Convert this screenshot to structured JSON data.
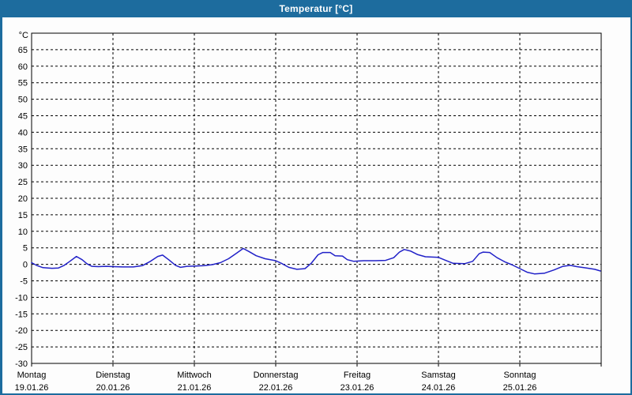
{
  "window": {
    "title": "Temperatur [°C]"
  },
  "colors": {
    "titlebar": "#1d6c9e",
    "window_border": "#1d6c9e",
    "content_bg": "#fdfdfd",
    "grid": "#000000",
    "axis": "#000000",
    "title_text": "#ffffff",
    "series_line": "#2121c8"
  },
  "chart_data": {
    "type": "line",
    "title": "Temperatur [°C]",
    "ylabel": "°C",
    "grid": {
      "style": "dashed",
      "horizontal": true,
      "vertical": true
    },
    "legend": "none",
    "y_axis": {
      "unit": "°C",
      "tick_min": -30,
      "tick_max": 65,
      "step": 5,
      "plot_top": 70,
      "ticks": [
        65,
        60,
        55,
        50,
        45,
        40,
        35,
        30,
        25,
        20,
        15,
        10,
        5,
        0,
        -5,
        -10,
        -15,
        -20,
        -25,
        -30
      ]
    },
    "x_axis": {
      "span_days": 7,
      "days": [
        {
          "name": "Montag",
          "date": "19.01.26"
        },
        {
          "name": "Dienstag",
          "date": "20.01.26"
        },
        {
          "name": "Mittwoch",
          "date": "21.01.26"
        },
        {
          "name": "Donnerstag",
          "date": "22.01.26"
        },
        {
          "name": "Freitag",
          "date": "23.01.26"
        },
        {
          "name": "Samstag",
          "date": "24.01.26"
        },
        {
          "name": "Sonntag",
          "date": "25.01.26"
        }
      ]
    },
    "series": [
      {
        "name": "Temperatur",
        "color": "#2121c8",
        "points_day_degC": [
          [
            0.0,
            0.5
          ],
          [
            0.06,
            -0.3
          ],
          [
            0.14,
            -1.0
          ],
          [
            0.25,
            -1.2
          ],
          [
            0.33,
            -1.1
          ],
          [
            0.4,
            -0.3
          ],
          [
            0.47,
            0.9
          ],
          [
            0.55,
            2.4
          ],
          [
            0.62,
            1.4
          ],
          [
            0.68,
            0.2
          ],
          [
            0.74,
            -0.6
          ],
          [
            0.82,
            -0.7
          ],
          [
            0.92,
            -0.6
          ],
          [
            1.0,
            -0.7
          ],
          [
            1.12,
            -0.8
          ],
          [
            1.25,
            -0.8
          ],
          [
            1.36,
            -0.4
          ],
          [
            1.46,
            0.9
          ],
          [
            1.55,
            2.4
          ],
          [
            1.61,
            2.8
          ],
          [
            1.69,
            1.3
          ],
          [
            1.77,
            -0.3
          ],
          [
            1.83,
            -0.9
          ],
          [
            1.91,
            -0.6
          ],
          [
            2.02,
            -0.5
          ],
          [
            2.12,
            -0.4
          ],
          [
            2.22,
            -0.1
          ],
          [
            2.32,
            0.5
          ],
          [
            2.42,
            1.7
          ],
          [
            2.52,
            3.4
          ],
          [
            2.6,
            4.8
          ],
          [
            2.67,
            3.9
          ],
          [
            2.76,
            2.6
          ],
          [
            2.87,
            1.7
          ],
          [
            3.0,
            1.1
          ],
          [
            3.07,
            0.3
          ],
          [
            3.16,
            -0.9
          ],
          [
            3.26,
            -1.5
          ],
          [
            3.36,
            -1.3
          ],
          [
            3.44,
            0.4
          ],
          [
            3.52,
            2.9
          ],
          [
            3.58,
            3.6
          ],
          [
            3.67,
            3.6
          ],
          [
            3.73,
            2.6
          ],
          [
            3.82,
            2.5
          ],
          [
            3.88,
            1.4
          ],
          [
            3.96,
            0.9
          ],
          [
            4.08,
            1.1
          ],
          [
            4.22,
            1.1
          ],
          [
            4.35,
            1.2
          ],
          [
            4.45,
            2.0
          ],
          [
            4.52,
            3.7
          ],
          [
            4.58,
            4.5
          ],
          [
            4.66,
            4.0
          ],
          [
            4.74,
            3.0
          ],
          [
            4.84,
            2.3
          ],
          [
            5.0,
            2.1
          ],
          [
            5.08,
            1.3
          ],
          [
            5.18,
            0.3
          ],
          [
            5.32,
            0.2
          ],
          [
            5.42,
            0.9
          ],
          [
            5.5,
            3.2
          ],
          [
            5.55,
            3.7
          ],
          [
            5.63,
            3.6
          ],
          [
            5.72,
            2.0
          ],
          [
            5.82,
            0.7
          ],
          [
            5.9,
            -0.1
          ],
          [
            6.0,
            -1.3
          ],
          [
            6.09,
            -2.4
          ],
          [
            6.18,
            -2.9
          ],
          [
            6.3,
            -2.7
          ],
          [
            6.42,
            -1.7
          ],
          [
            6.53,
            -0.6
          ],
          [
            6.62,
            -0.3
          ],
          [
            6.7,
            -0.7
          ],
          [
            6.82,
            -1.1
          ],
          [
            6.92,
            -1.5
          ],
          [
            6.99,
            -2.0
          ]
        ]
      }
    ]
  }
}
